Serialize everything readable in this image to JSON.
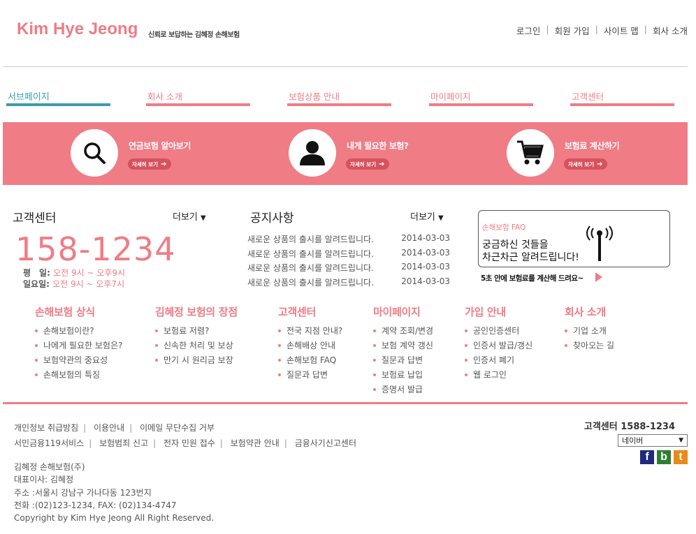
{
  "header": {
    "logo": "Kim Hye Jeong",
    "tagline": "신뢰로 보답하는 김혜정 손해보험",
    "links": [
      "로그인",
      "회원 가입",
      "사이트 맵",
      "회사 소개"
    ]
  },
  "nav": {
    "items": [
      "서브페이지",
      "회사 소개",
      "보험상품 안내",
      "마이페이지",
      "고객센터"
    ]
  },
  "banner": {
    "items": [
      {
        "title": "연금보험 알아보기",
        "button": "자세히 보기",
        "icon": "search-icon"
      },
      {
        "title": "내게 필요한 보험?",
        "button": "자세히 보기",
        "icon": "person-icon"
      },
      {
        "title": "보험료 계산하기",
        "button": "자세히 보기",
        "icon": "cart-icon"
      }
    ]
  },
  "customer_center": {
    "title": "고객센터",
    "more": "더보기",
    "phone": "158-1234",
    "weekday_label": "평　일:",
    "weekday_hours": "오전 9시 ~ 오후9시",
    "sunday_label": "일요일:",
    "sunday_hours": "오전 9시 ~ 오후7시"
  },
  "notices": {
    "title": "공지사항",
    "more": "더보기",
    "rows": [
      {
        "text": "새로운 상품의 출시를 알려드립니다.",
        "date": "2014-03-03"
      },
      {
        "text": "새로운 상품의 출시를 알려드립니다.",
        "date": "2014-03-03"
      },
      {
        "text": "새로운 상품의 출시를 알려드립니다.",
        "date": "2014-03-03"
      },
      {
        "text": "새로운 상품의 출시를 알려드립니다.",
        "date": "2014-03-03"
      }
    ]
  },
  "faq": {
    "label": "손해보험 FAQ",
    "line1": "궁금하신 것들을",
    "line2": "차근차근 알려드립니다!",
    "cta": "5초 안에 보험료를 계산해 드려요~"
  },
  "sitemap": [
    {
      "title": "손해보험 상식",
      "items": [
        "손해보험이란?",
        "나에게 필요한 보험은?",
        "보험약관의 중요성",
        "손해보험의 특징"
      ]
    },
    {
      "title": "김혜정 보험의 장점",
      "items": [
        "보험료 저렴?",
        "신속한 처리 및 보상",
        "만기 시 원리금 보장"
      ]
    },
    {
      "title": "고객센터",
      "items": [
        "전국 지점 안내?",
        "손해배상 안내",
        "손해보험 FAQ",
        "질문과 답변"
      ]
    },
    {
      "title": "마이페이지",
      "items": [
        "계약 조회/변경",
        "보험 계약 갱신",
        "질문과 답변",
        "보험료 납입",
        "증명서 발급"
      ]
    },
    {
      "title": "가입 안내",
      "items": [
        "공인인증센터",
        "인증서 발급/갱신",
        "인증서 폐기",
        "웹 로그인"
      ]
    },
    {
      "title": "회사 소개",
      "items": [
        "기업 소개",
        "찾아오는 길"
      ]
    }
  ],
  "footer": {
    "links_row1": [
      "개인정보 취급방침",
      "이용안내",
      "이메일 무단수집 거부"
    ],
    "links_row2": [
      "서민금융119서비스",
      "보험범죄 신고",
      "전자 민원 접수",
      "보험약관 안내",
      "금융사기신고센터"
    ],
    "company": "김혜정 손해보험(주)",
    "ceo": "대표이사: 김혜정",
    "address": "주소 :서울시 강남구 가나다동 123번지",
    "tel": "전화 :(02)123-1234, FAX: (02)134-4747",
    "copyright": "Copyright by Kim Hye Jeong All Right Reserved.",
    "center_label": "고객센터 1588-1234",
    "select_value": "네이버",
    "social": [
      {
        "glyph": "f",
        "color": "#1f2a7a"
      },
      {
        "glyph": "b",
        "color": "#2f7d32"
      },
      {
        "glyph": "t",
        "color": "#e88a1a"
      }
    ]
  }
}
